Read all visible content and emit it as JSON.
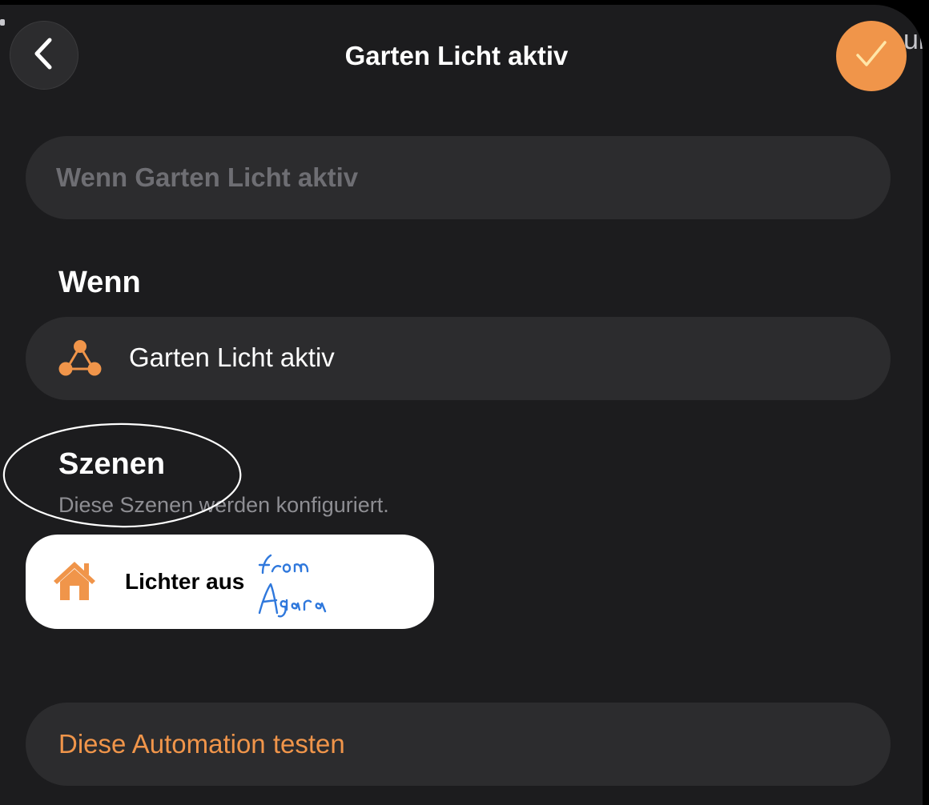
{
  "header": {
    "title": "Garten Licht aktiv",
    "back_icon": "chevron-left-icon",
    "done_icon": "checkmark-icon",
    "accent_color": "#f0954a"
  },
  "name_field": {
    "placeholder": "Wenn Garten Licht aktiv"
  },
  "when_section": {
    "heading": "Wenn",
    "trigger": {
      "icon": "automation-nodes-icon",
      "label": "Garten Licht aktiv"
    }
  },
  "scenes_section": {
    "heading": "Szenen",
    "subtitle": "Diese Szenen werden konfiguriert.",
    "scenes": [
      {
        "icon": "house-icon",
        "label": "Lichter aus"
      }
    ]
  },
  "annotation": {
    "handwritten_note": "from Agara"
  },
  "actions": {
    "test_label": "Diese Automation testen"
  },
  "edge_text": "ui"
}
